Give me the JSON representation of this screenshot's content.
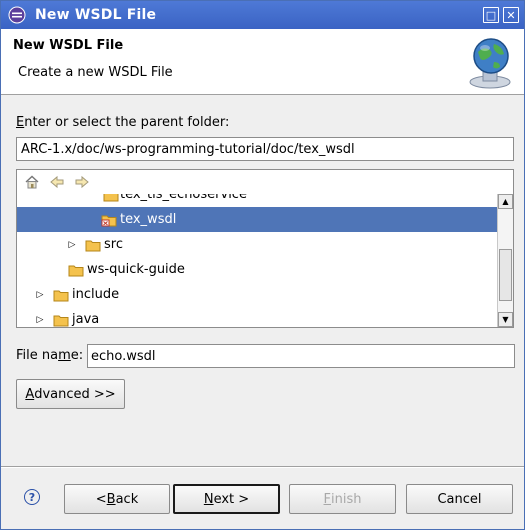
{
  "window": {
    "title": "New WSDL File",
    "maximize_glyph": "□",
    "close_glyph": "✕"
  },
  "banner": {
    "heading": "New WSDL File",
    "description": "Create a new WSDL File"
  },
  "parent_folder": {
    "label_mnemonic": "E",
    "label_rest": "nter or select the parent folder:",
    "value": "ARC-1.x/doc/ws-programming-tutorial/doc/tex_wsdl"
  },
  "tree": {
    "toolbar": [
      "home-icon",
      "back-arrow-icon",
      "forward-arrow-icon"
    ],
    "items": [
      {
        "label": "tex_tls_echoservice",
        "expandable": false,
        "selected": false,
        "icon": "folder-icon"
      },
      {
        "label": "tex_wsdl",
        "expandable": false,
        "selected": true,
        "icon": "wsdl-folder-icon"
      },
      {
        "label": "src",
        "expandable": true,
        "selected": false,
        "icon": "folder-icon"
      },
      {
        "label": "ws-quick-guide",
        "expandable": false,
        "selected": false,
        "icon": "folder-icon"
      },
      {
        "label": "include",
        "expandable": true,
        "selected": false,
        "icon": "folder-icon"
      },
      {
        "label": "java",
        "expandable": true,
        "selected": false,
        "icon": "folder-icon"
      }
    ]
  },
  "file_name": {
    "label_pre": "File na",
    "label_mnemonic": "m",
    "label_post": "e:",
    "value": "echo.wsdl"
  },
  "buttons": {
    "advanced_mnemonic": "A",
    "advanced_rest": "dvanced >>",
    "back_pre": "< ",
    "back_mnemonic": "B",
    "back_rest": "ack",
    "next_mnemonic": "N",
    "next_rest": "ext >",
    "finish_mnemonic": "F",
    "finish_rest": "inish",
    "cancel": "Cancel",
    "help": "?"
  },
  "colors": {
    "titlebar": "#3f68c8",
    "selection": "#4f75b7",
    "folder": "#f2b233"
  }
}
